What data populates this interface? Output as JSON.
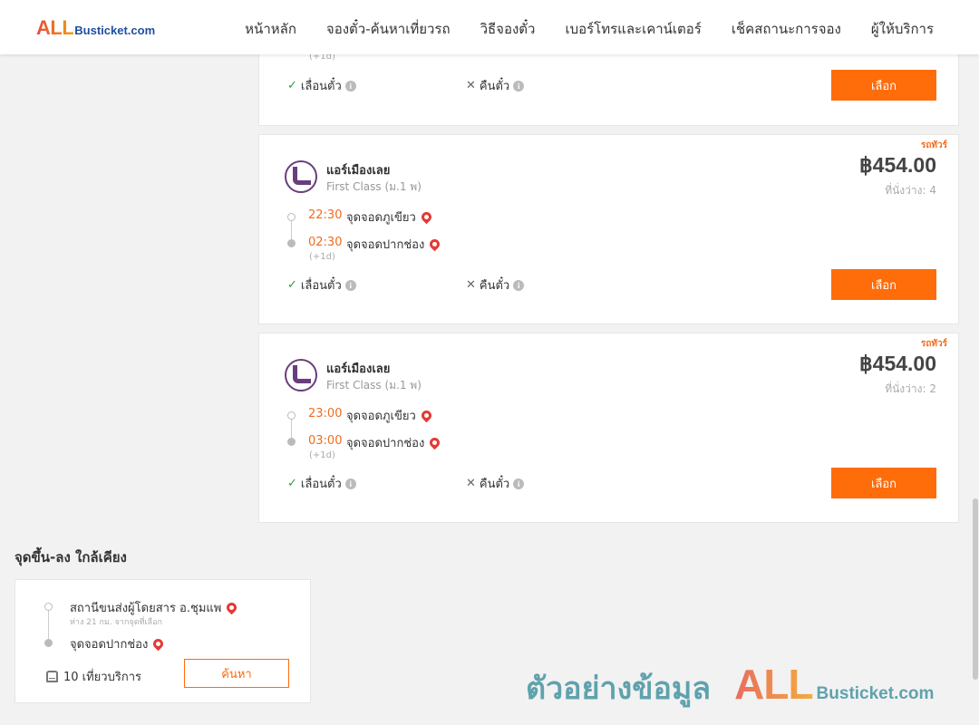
{
  "header": {
    "logo_all": "ALL",
    "logo_domain": "Busticket.com",
    "nav": [
      "หน้าหลัก",
      "จองตั๋ว-ค้นหาเที่ยวรถ",
      "วิธีจองตั๋ว",
      "เบอร์โทรและเคาน์เตอร์",
      "เช็คสถานะการจอง",
      "ผู้ให้บริการ"
    ]
  },
  "trips": [
    {
      "plus_day": "(+1d)",
      "reschedule": "เลื่อนตั๋ว",
      "refund": "คืนตั๋ว",
      "select_label": "เลือก"
    },
    {
      "ribbon": "รถทัวร์",
      "operator": "แอร์เมืองเลย",
      "bus_class": "First Class (ม.1 พ)",
      "price": "฿454.00",
      "seats": "ที่นั่งว่าง: 4",
      "depart_time": "22:30",
      "depart_stop": "จุดจอดภูเขียว",
      "arrive_time": "02:30",
      "arrive_stop": "จุดจอดปากช่อง",
      "plus_day": "(+1d)",
      "reschedule": "เลื่อนตั๋ว",
      "refund": "คืนตั๋ว",
      "select_label": "เลือก"
    },
    {
      "ribbon": "รถทัวร์",
      "operator": "แอร์เมืองเลย",
      "bus_class": "First Class (ม.1 พ)",
      "price": "฿454.00",
      "seats": "ที่นั่งว่าง: 2",
      "depart_time": "23:00",
      "depart_stop": "จุดจอดภูเขียว",
      "arrive_time": "03:00",
      "arrive_stop": "จุดจอดปากช่อง",
      "plus_day": "(+1d)",
      "reschedule": "เลื่อนตั๋ว",
      "refund": "คืนตั๋ว",
      "select_label": "เลือก"
    }
  ],
  "nearby": {
    "title": "จุดขึ้น-ลง ใกล้เคียง",
    "from": "สถานีขนส่งผู้โดยสาร อ.ชุมแพ",
    "distance": "ห่าง 21 กม. จากจุดที่เลือก",
    "to": "จุดจอดปากช่อง",
    "trips": "10 เที่ยวบริการ",
    "search_label": "ค้นหา"
  },
  "watermark": {
    "text": "ตัวอย่างข้อมูล",
    "logo_all": "ALL",
    "logo_domain": "Busticket.com"
  },
  "colors": {
    "accent": "#ff6c0a",
    "time": "#f26b1d",
    "pin": "#e53935",
    "check": "#2e9d3a"
  }
}
